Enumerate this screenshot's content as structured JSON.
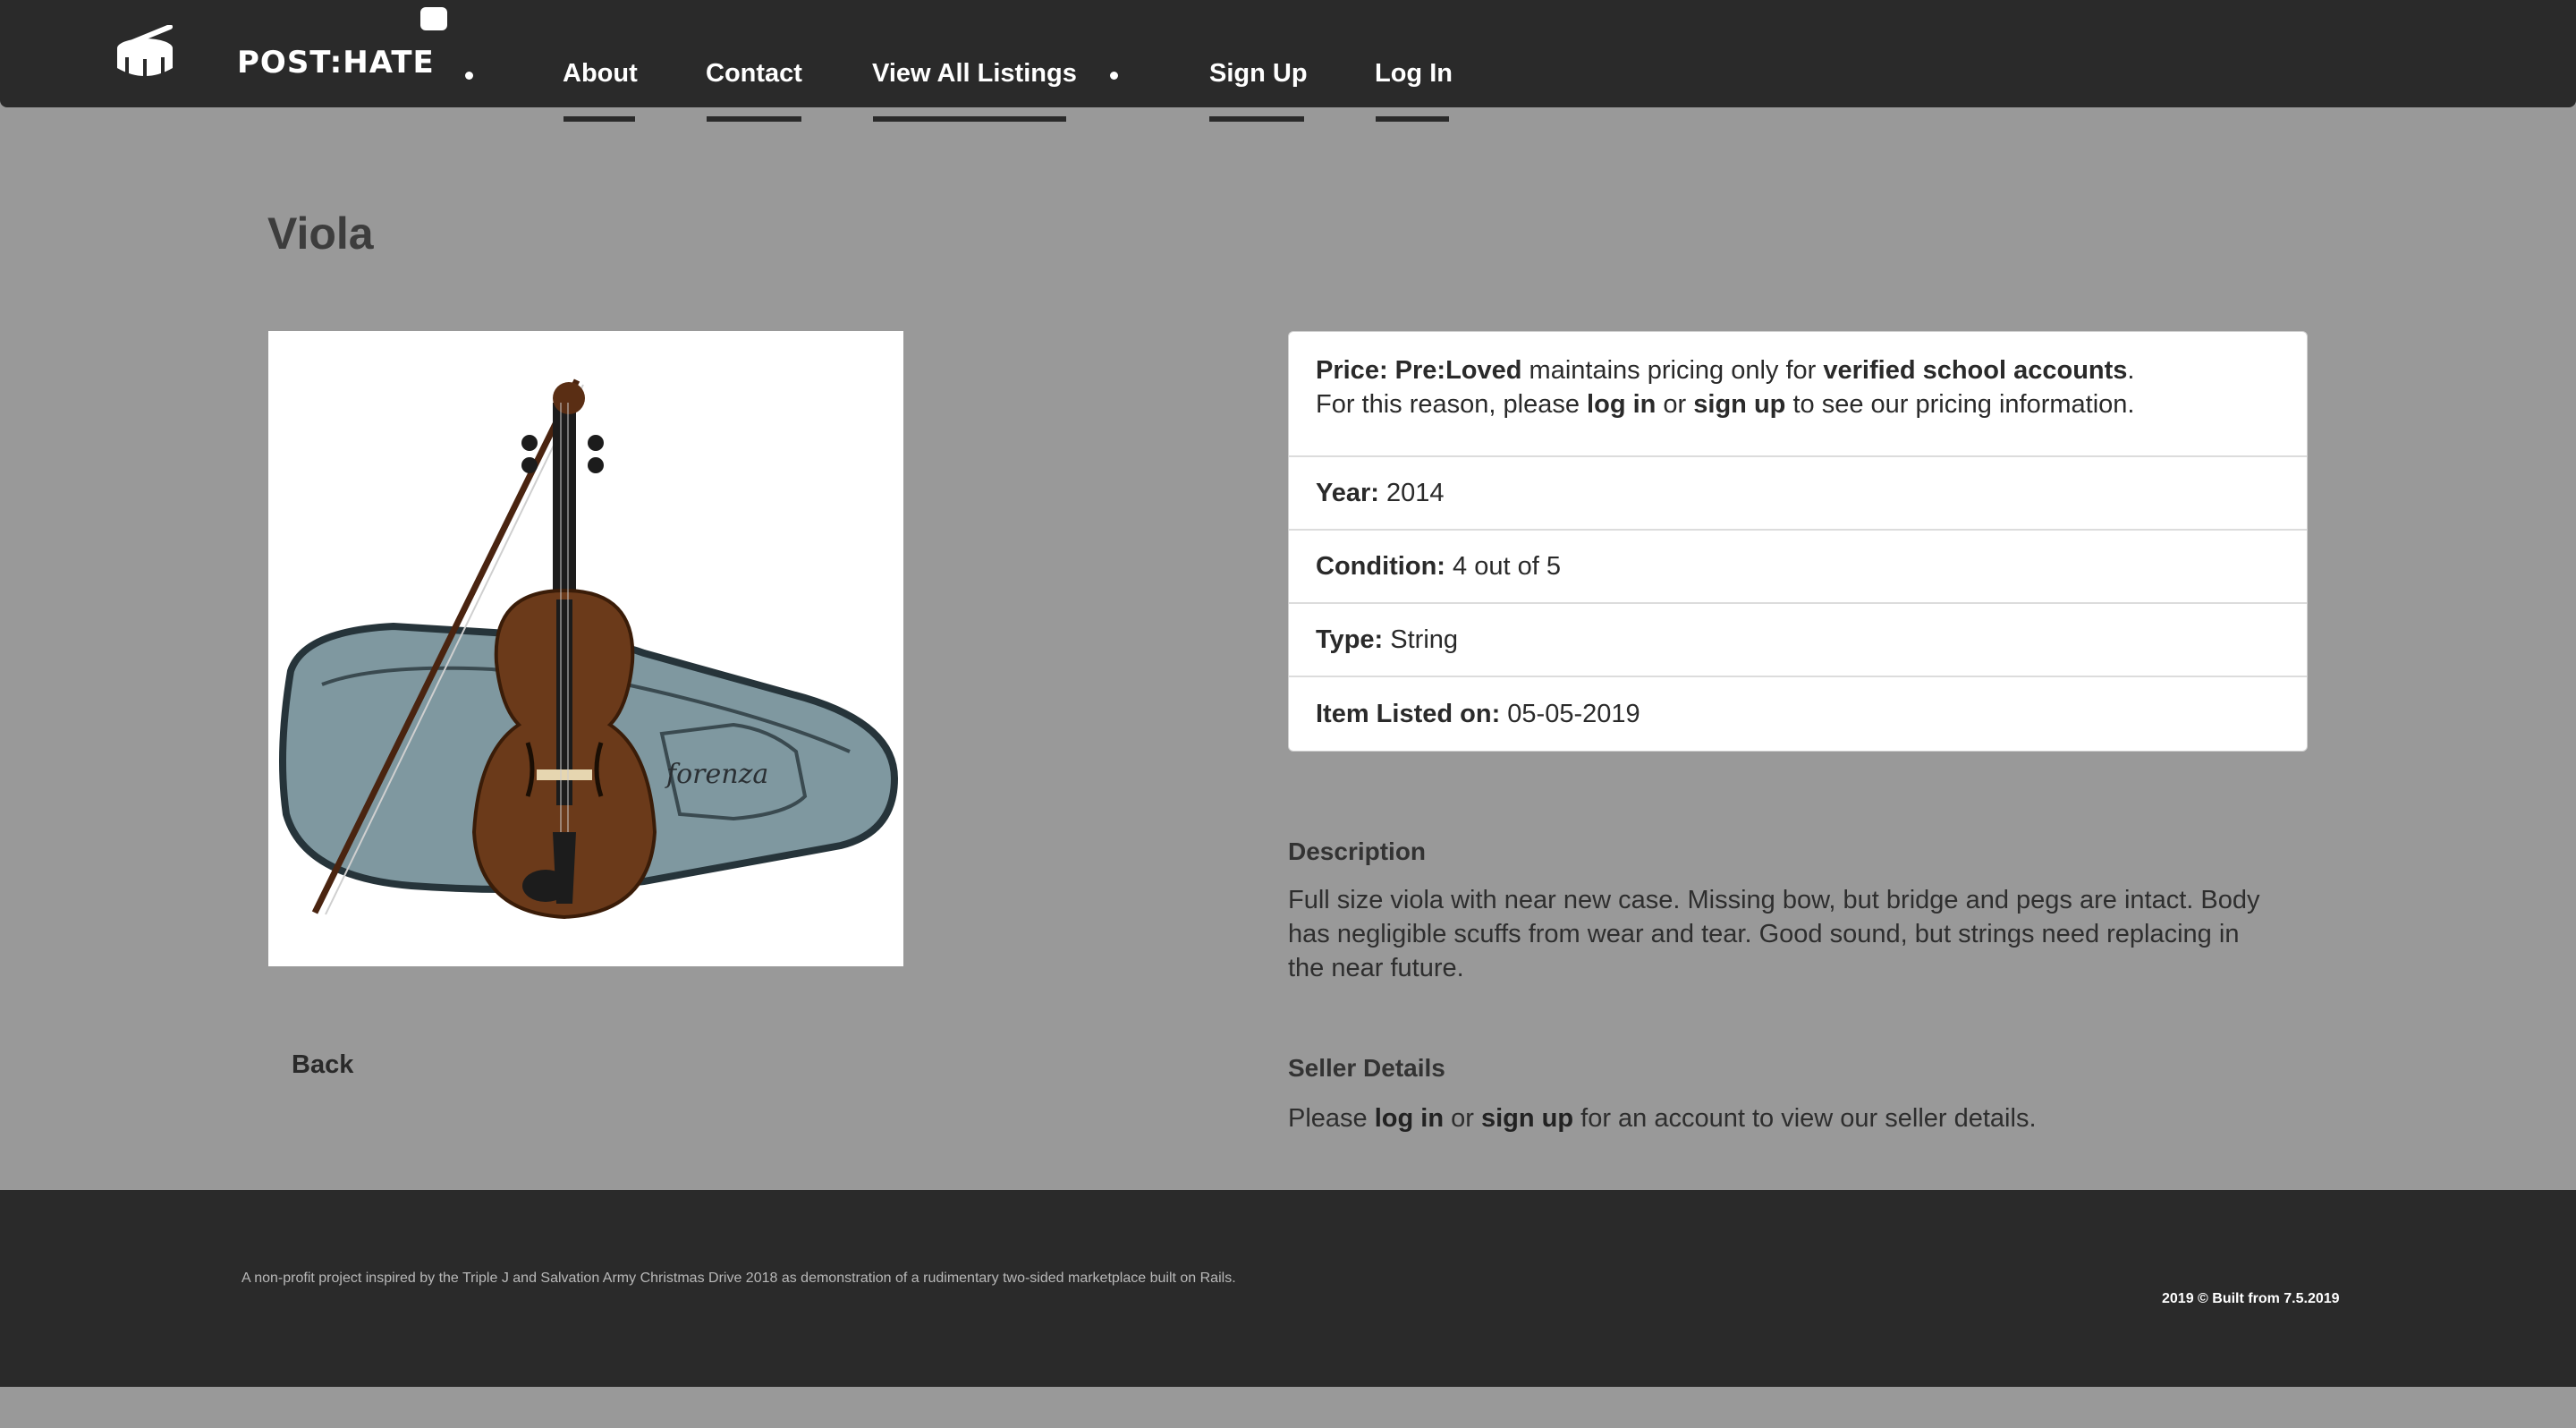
{
  "header": {
    "brand": "POST:HATE",
    "nav": {
      "about": "About",
      "contact": "Contact",
      "listings": "View All Listings",
      "signup": "Sign Up",
      "login": "Log In"
    }
  },
  "listing": {
    "title": "Viola",
    "image_alt": "Viola with case and bow",
    "price": {
      "label": "Price:",
      "brand": "Pre:Loved",
      "text1": " maintains pricing only for ",
      "verified": "verified school accounts",
      "period": ".",
      "text2": "For this reason, please ",
      "login": "log in",
      "or": " or ",
      "signup": "sign up",
      "text3": " to see our pricing information."
    },
    "year": {
      "label": "Year:",
      "value": "2014"
    },
    "condition": {
      "label": "Condition:",
      "value": "4 out of 5"
    },
    "type": {
      "label": "Type:",
      "value": "String"
    },
    "listed": {
      "label": "Item Listed on:",
      "value": "05-05-2019"
    },
    "description_heading": "Description",
    "description": "Full size viola with near new case. Missing bow, but bridge and pegs are intact. Body has negligible scuffs from wear and tear. Good sound, but strings need replacing in the near future.",
    "seller_heading": "Seller Details",
    "seller": {
      "please": "Please ",
      "login": "log in",
      "or": " or ",
      "signup": "sign up",
      "rest": " for an account to view our seller details."
    },
    "image_logo_text": "forenza"
  },
  "back_label": "Back",
  "footer": {
    "left": "A non-profit project inspired by the Triple J and Salvation Army Christmas Drive 2018 as demonstration of a rudimentary two-sided marketplace built on Rails.",
    "right": "2019 © Built from 7.5.2019"
  },
  "colors": {
    "page_bg": "#999999",
    "nav_bg": "#2a2a2a",
    "case": "#7f98a0",
    "violin_wood": "#6b3a1a"
  }
}
